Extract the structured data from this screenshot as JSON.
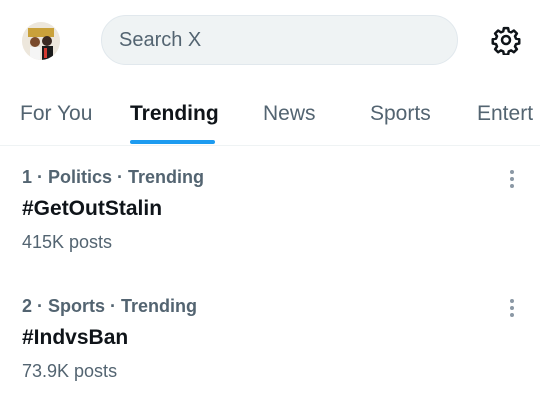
{
  "header": {
    "search_placeholder": "Search X",
    "avatar_icon": "profile-avatar",
    "settings_icon": "gear-icon"
  },
  "tabs": [
    {
      "label": "For You",
      "active": false
    },
    {
      "label": "Trending",
      "active": true
    },
    {
      "label": "News",
      "active": false
    },
    {
      "label": "Sports",
      "active": false
    },
    {
      "label": "Entert",
      "active": false
    }
  ],
  "trends": [
    {
      "meta": "1 · Politics · Trending",
      "name": "#GetOutStalin",
      "count": "415K posts"
    },
    {
      "meta": "2 · Sports · Trending",
      "name": "#IndvsBan",
      "count": "73.9K posts"
    }
  ],
  "colors": {
    "accent": "#1d9bf0",
    "muted_text": "#536471",
    "primary_text": "#0f1419",
    "search_bg": "#eff3f4"
  }
}
